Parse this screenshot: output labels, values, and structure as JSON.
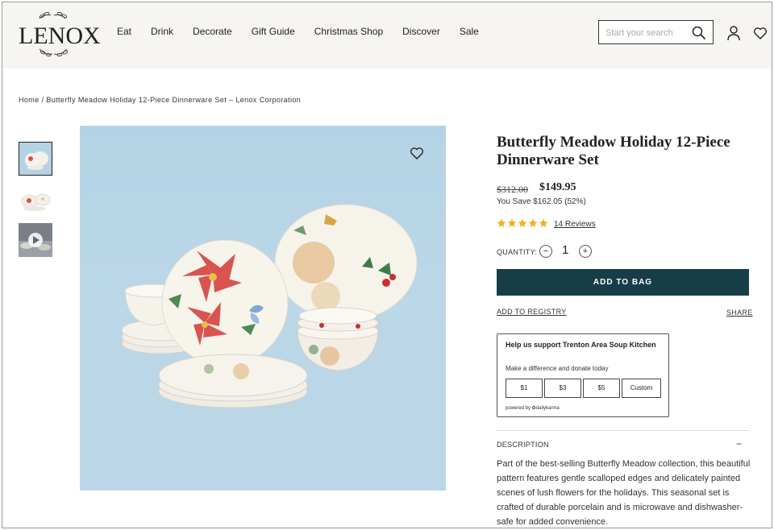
{
  "header": {
    "logo_text": "LENOX",
    "nav": [
      "Eat",
      "Drink",
      "Decorate",
      "Gift Guide",
      "Christmas Shop",
      "Discover",
      "Sale"
    ],
    "search_placeholder": "Start your search"
  },
  "breadcrumb": {
    "home": "Home",
    "separator": " / ",
    "current": "Butterfly Meadow Holiday 12-Piece Dinnerware Set – Lenox Corporation"
  },
  "product": {
    "title": "Butterfly Meadow Holiday 12-Piece Dinnerware Set",
    "original_price": "$312.00",
    "sale_price": "$149.95",
    "savings": "You Save $162.05 (52%)",
    "rating": 5,
    "reviews": "14 Reviews",
    "quantity_label": "QUANTITY:",
    "quantity": "1",
    "minus": "−",
    "plus": "+",
    "add_to_bag": "ADD TO BAG",
    "add_to_registry": "ADD TO REGISTRY",
    "share": "SHARE"
  },
  "donation": {
    "title": "Help us support Trenton Area Soup Kitchen",
    "subtitle": "Make a difference and donate today",
    "options": [
      "$1",
      "$3",
      "$5",
      "Custom"
    ],
    "powered_by": "powered by ✿dailykarma"
  },
  "description": {
    "label": "DESCRIPTION",
    "toggle": "−",
    "text": "Part of the best-selling Butterfly Meadow collection, this beautiful pattern features gentle scalloped edges and delicately painted scenes of lush flowers for the holidays. This seasonal set is crafted of durable porcelain and is microwave and dishwasher-safe for added convenience."
  },
  "colors": {
    "header_bg": "#f6f5f1",
    "add_to_bag_bg": "#173e48",
    "star": "#f2b01e",
    "hero_bg": "#b5d3e3"
  },
  "icons": [
    "search-icon",
    "user-icon",
    "heart-icon",
    "play-icon",
    "star-icon"
  ]
}
